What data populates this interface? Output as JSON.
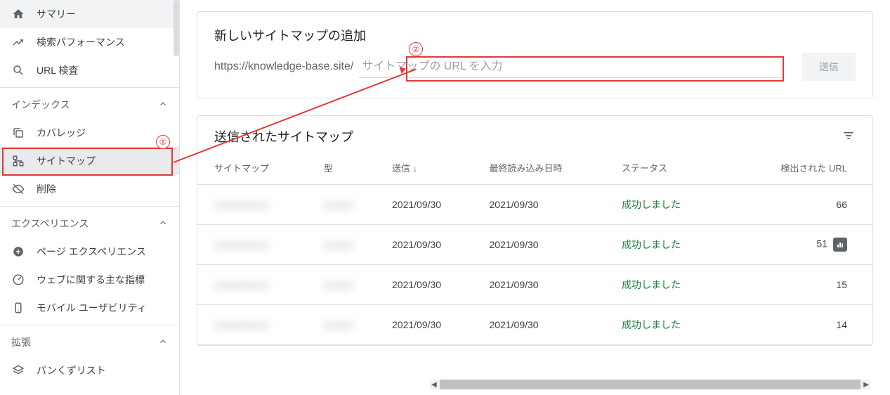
{
  "sidebar": {
    "items_top": [
      {
        "icon": "home",
        "label": "サマリー"
      },
      {
        "icon": "trending",
        "label": "検索パフォーマンス"
      },
      {
        "icon": "search",
        "label": "URL 検査"
      }
    ],
    "section_index": {
      "label": "インデックス",
      "items": [
        {
          "icon": "copy",
          "label": "カバレッジ"
        },
        {
          "icon": "tree",
          "label": "サイトマップ",
          "active": true
        },
        {
          "icon": "hide",
          "label": "削除"
        }
      ]
    },
    "section_experience": {
      "label": "エクスペリエンス",
      "items": [
        {
          "icon": "plus-circle",
          "label": "ページ エクスペリエンス"
        },
        {
          "icon": "speed",
          "label": "ウェブに関する主な指標"
        },
        {
          "icon": "mobile",
          "label": "モバイル ユーザビリティ"
        }
      ]
    },
    "section_enhancement": {
      "label": "拡張",
      "items": [
        {
          "icon": "layers",
          "label": "パンくずリスト"
        }
      ]
    }
  },
  "add_sitemap": {
    "title": "新しいサイトマップの追加",
    "prefix": "https://knowledge-base.site/",
    "placeholder": "サイトマップの URL を入力",
    "submit": "送信"
  },
  "submitted": {
    "title": "送信されたサイトマップ",
    "columns": {
      "sitemap": "サイトマップ",
      "type": "型",
      "submitted": "送信",
      "last_read": "最終読み込み日時",
      "status": "ステータス",
      "urls": "検出された URL"
    },
    "rows": [
      {
        "submitted": "2021/09/30",
        "last_read": "2021/09/30",
        "status": "成功しました",
        "urls": "66"
      },
      {
        "submitted": "2021/09/30",
        "last_read": "2021/09/30",
        "status": "成功しました",
        "urls": "51",
        "chart": true
      },
      {
        "submitted": "2021/09/30",
        "last_read": "2021/09/30",
        "status": "成功しました",
        "urls": "15"
      },
      {
        "submitted": "2021/09/30",
        "last_read": "2021/09/30",
        "status": "成功しました",
        "urls": "14"
      }
    ]
  },
  "annotations": {
    "label1": "①",
    "label2": "②"
  }
}
